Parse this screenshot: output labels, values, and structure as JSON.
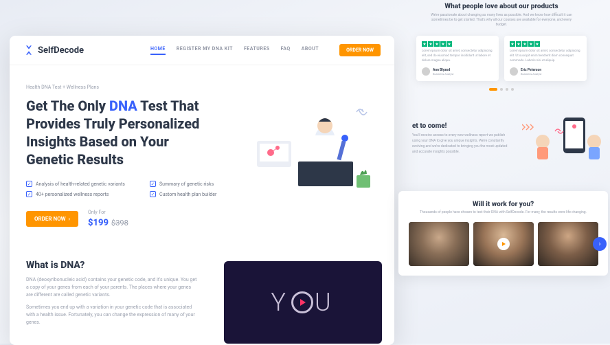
{
  "brand": "SelfDecode",
  "nav": {
    "links": [
      "HOME",
      "REGISTER MY DNA KIT",
      "FEATURES",
      "FAQ",
      "ABOUT"
    ],
    "cta": "ORDER NOW"
  },
  "hero": {
    "breadcrumb": "Health DNA Test + Wellness Plans",
    "h1_pre": "Get The Only ",
    "h1_hl": "DNA",
    "h1_post": " Test That Provides Truly Personalized Insights Based on Your Genetic Results",
    "features": [
      "Analysis of health-related genetic variants",
      "Summary of genetic risks",
      "40+ personalized wellness reports",
      "Custom health plan builder"
    ],
    "order": "ORDER NOW",
    "only_for": "Only For",
    "price": "$199",
    "old_price": "$398"
  },
  "what_dna": {
    "title": "What is DNA?",
    "p1": "DNA (deoxyribonucleic acid) contains your genetic code, and it's unique. You get a copy of your genes from each of your parents. The places where your genes are different are called genetic variants.",
    "p2": "Sometimes you end up with a variation in your genetic code that is associated with a health issue. Fortunately, you can change the expression of many of your genes."
  },
  "you": {
    "y": "Y",
    "u": "U"
  },
  "testimonials": {
    "title": "What people love about our products",
    "sub": "We're passionate about changing as many lives as possible. And we know how difficult it can sometimes be to get started. That's why all our courses are available for everyone, and every budget.",
    "cards": [
      {
        "text": "Lorem ipsum dolor sit amet, consectetur adipiscing elit, sed do eiusmod tempor incididunt ut labore et dolore magna aliqua.",
        "name": "Ann Blyzed",
        "role": "Business Analyst"
      },
      {
        "text": "Lorem ipsum dolor sit amet, consectetur adipiscing elit. Ut suscipit enim hendrerit diam consequat commodo. Laboris nisi ut aliquip.",
        "name": "Eric Peterson",
        "role": "Business Analyst"
      }
    ]
  },
  "best": {
    "title_suffix": "et to come!",
    "text": "You'll receive access to every new wellness report we publish using your DNA to give you unique insights. We're constantly evolving and we're dedicated to bringing you the most updated and accurate insights possible."
  },
  "work": {
    "title": "Will it work for you?",
    "sub": "Thousands of people have chosen to test their DNA with SelfDecode. For many, the results were life changing."
  }
}
